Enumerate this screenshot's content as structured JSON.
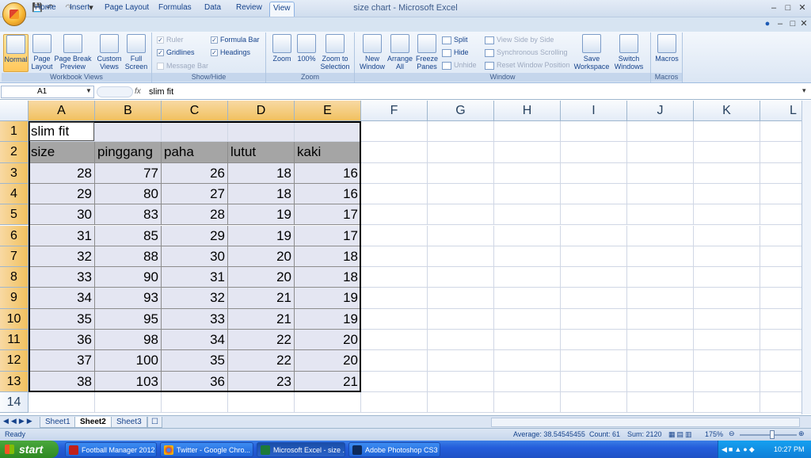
{
  "app": {
    "title": "size chart - Microsoft Excel"
  },
  "tabs": [
    "Home",
    "Insert",
    "Page Layout",
    "Formulas",
    "Data",
    "Review",
    "View"
  ],
  "active_tab": "View",
  "ribbon": {
    "workbook_views": {
      "label": "Workbook Views",
      "buttons": [
        "Normal",
        "Page Layout",
        "Page Break Preview",
        "Custom Views",
        "Full Screen"
      ]
    },
    "show_hide": {
      "label": "Show/Hide",
      "ruler": "Ruler",
      "gridlines": "Gridlines",
      "message_bar": "Message Bar",
      "formula_bar": "Formula Bar",
      "headings": "Headings"
    },
    "zoom": {
      "label": "Zoom",
      "buttons": [
        "Zoom",
        "100%",
        "Zoom to Selection"
      ]
    },
    "window": {
      "label": "Window",
      "buttons": [
        "New Window",
        "Arrange All",
        "Freeze Panes"
      ],
      "split": "Split",
      "hide": "Hide",
      "unhide": "Unhide",
      "view_side": "View Side by Side",
      "sync_scroll": "Synchronous Scrolling",
      "reset_pos": "Reset Window Position",
      "save_ws": "Save Workspace",
      "switch": "Switch Windows"
    },
    "macros": {
      "label": "Macros",
      "button": "Macros"
    }
  },
  "formula_bar": {
    "name_box": "A1",
    "fx": "fx",
    "content": "slim fit"
  },
  "columns": [
    "A",
    "B",
    "C",
    "D",
    "E",
    "F",
    "G",
    "H",
    "I",
    "J",
    "K",
    "L"
  ],
  "rows": [
    "1",
    "2",
    "3",
    "4",
    "5",
    "6",
    "7",
    "8",
    "9",
    "10",
    "11",
    "12",
    "13",
    "14"
  ],
  "sheet": {
    "title": "slim fit",
    "headers": [
      "size",
      "pinggang",
      "paha",
      "lutut",
      "kaki"
    ],
    "data": [
      [
        "28",
        "77",
        "26",
        "18",
        "16"
      ],
      [
        "29",
        "80",
        "27",
        "18",
        "16"
      ],
      [
        "30",
        "83",
        "28",
        "19",
        "17"
      ],
      [
        "31",
        "85",
        "29",
        "19",
        "17"
      ],
      [
        "32",
        "88",
        "30",
        "20",
        "18"
      ],
      [
        "33",
        "90",
        "31",
        "20",
        "18"
      ],
      [
        "34",
        "93",
        "32",
        "21",
        "19"
      ],
      [
        "35",
        "95",
        "33",
        "21",
        "19"
      ],
      [
        "36",
        "98",
        "34",
        "22",
        "20"
      ],
      [
        "37",
        "100",
        "35",
        "22",
        "20"
      ],
      [
        "38",
        "103",
        "36",
        "23",
        "21"
      ]
    ]
  },
  "sheet_tabs": [
    "Sheet1",
    "Sheet2",
    "Sheet3"
  ],
  "active_sheet": "Sheet2",
  "status": {
    "ready": "Ready",
    "average": "Average: 38.54545455",
    "count": "Count: 61",
    "sum": "Sum: 2120",
    "zoom": "175%"
  },
  "taskbar": {
    "start": "start",
    "tasks": [
      "Football Manager 2012",
      "Twitter - Google Chro...",
      "Microsoft Excel - size ...",
      "Adobe Photoshop CS3"
    ],
    "clock": "10:27 PM"
  }
}
